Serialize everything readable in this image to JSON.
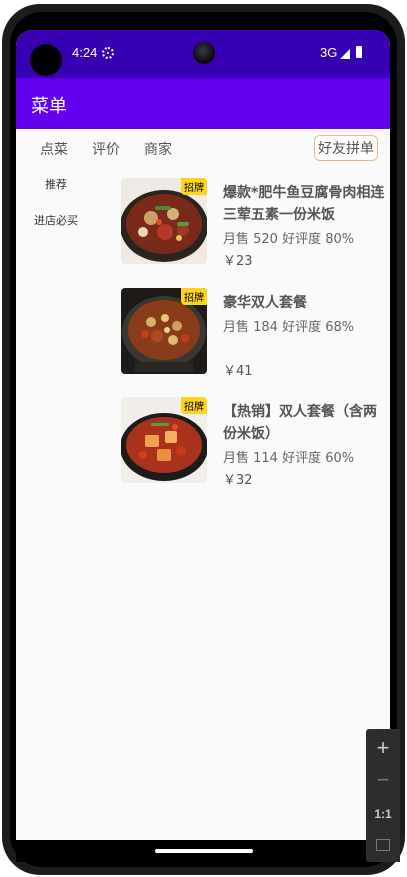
{
  "status_bar": {
    "time": "4:24",
    "network": "3G",
    "icons": [
      "gear-icon",
      "signal-icon",
      "battery-icon"
    ]
  },
  "app_bar": {
    "title": "菜单",
    "color": "#6200ee",
    "status_color": "#3700b3"
  },
  "tabs": [
    {
      "label": "点菜"
    },
    {
      "label": "评价"
    },
    {
      "label": "商家"
    }
  ],
  "group_order_button": "好友拼单",
  "categories": [
    {
      "label": "推荐"
    },
    {
      "label": "进店必买"
    }
  ],
  "dishes": [
    {
      "name": "爆款*肥牛鱼豆腐骨肉相连三荤五素一份米饭",
      "sales": "月售 520 好评度 80%",
      "price": "￥23",
      "badge": "招牌"
    },
    {
      "name": "豪华双人套餐",
      "sales": "月售 184 好评度 68%",
      "price": "￥41",
      "badge": "招牌"
    },
    {
      "name": "【热销】双人套餐（含两份米饭）",
      "sales": "月售 114 好评度 60%",
      "price": "￥32",
      "badge": "招牌"
    }
  ],
  "zoom_controls": {
    "zoom_in": "+",
    "zoom_out": "−",
    "actual_size": "1:1"
  },
  "colors": {
    "badge": "#ffd21f",
    "group_border": "#f0b87e"
  }
}
